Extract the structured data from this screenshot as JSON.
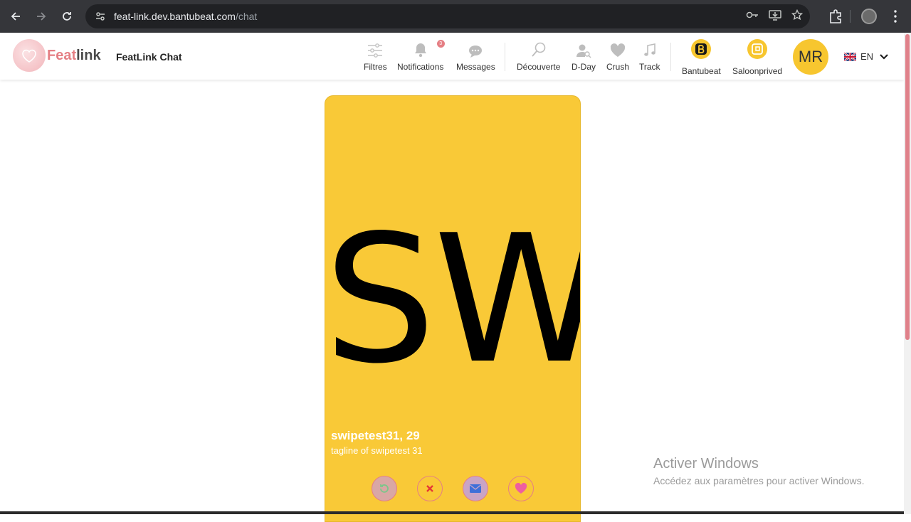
{
  "browser": {
    "url_host": "feat-link.dev.bantubeat.com",
    "url_path": "/chat"
  },
  "header": {
    "logo_part1": "Feat",
    "logo_part2": "link",
    "app_title": "FeatLink Chat",
    "nav": [
      {
        "label": "Filtres",
        "icon": "sliders-icon"
      },
      {
        "label": "Notifications",
        "icon": "bell-icon",
        "badge": "3"
      },
      {
        "label": "Messages",
        "icon": "chat-bubble-icon"
      },
      {
        "label": "Découverte",
        "icon": "search-icon"
      },
      {
        "label": "D-Day",
        "icon": "user-search-icon"
      },
      {
        "label": "Crush",
        "icon": "heart-icon"
      },
      {
        "label": "Track",
        "icon": "music-note-icon"
      }
    ],
    "partners": [
      {
        "label": "Bantubeat",
        "icon": "bantubeat-logo-icon"
      },
      {
        "label": "Saloonprived",
        "icon": "saloonprived-logo-icon"
      }
    ],
    "avatar_initials": "MR",
    "language": "EN"
  },
  "profile_card": {
    "initials": "SW",
    "name_age": "swipetest31, 29",
    "tagline": "tagline of swipetest 31",
    "background_color": "#f9c937",
    "actions": [
      "undo-icon",
      "close-icon",
      "mail-icon",
      "heart-icon"
    ]
  },
  "watermark": {
    "title": "Activer Windows",
    "subtitle": "Accédez aux paramètres pour activer Windows."
  },
  "colors": {
    "accent": "#e57f84",
    "brand_yellow": "#f7c62f"
  }
}
